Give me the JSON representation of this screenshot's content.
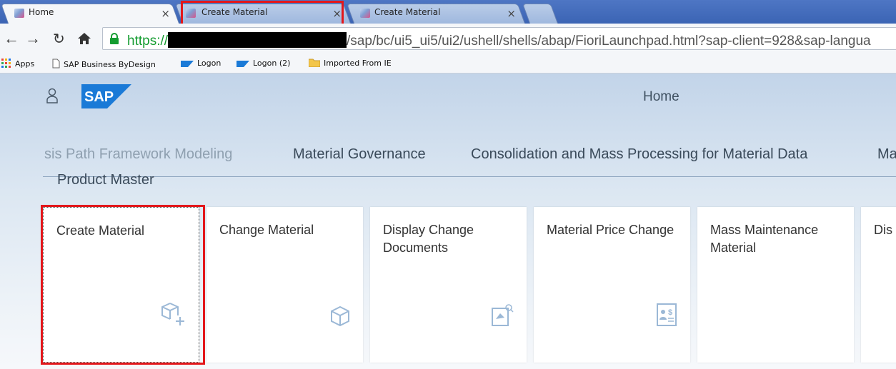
{
  "browser": {
    "tabs": [
      {
        "title": "Home",
        "close": "×"
      },
      {
        "title": "Create Material",
        "close": "×"
      },
      {
        "title": "Create Material",
        "close": "×"
      }
    ],
    "url_scheme": "https://",
    "url_path": "/sap/bc/ui5_ui5/ui2/ushell/shells/abap/FioriLaunchpad.html?sap-client=928&sap-langua",
    "bookmarks": [
      "Apps",
      "SAP Business ByDesign",
      "Logon",
      "Logon (2)",
      "Imported From IE"
    ]
  },
  "shell": {
    "title": "Home",
    "logo_text": "SAP"
  },
  "groups": {
    "tabs": [
      "sis Path Framework Modeling",
      "Material Governance",
      "Consolidation and Mass Processing for Material Data",
      "Ma"
    ],
    "current_group": "Product Master"
  },
  "tiles": [
    {
      "title": "Create Material",
      "icon": "product-add-icon"
    },
    {
      "title": "Change Material",
      "icon": "product-icon"
    },
    {
      "title": "Display Change Documents",
      "icon": "document-search-icon"
    },
    {
      "title": "Material Price Change",
      "icon": "price-document-icon"
    },
    {
      "title": "Mass Maintenance Material",
      "icon": ""
    },
    {
      "title": "Dis",
      "icon": ""
    }
  ],
  "colors": {
    "highlight": "#e3171b",
    "tab_strip": "#3b64b4",
    "sap_blue": "#1a7ad7",
    "icon_blue": "#9bb8d6"
  }
}
